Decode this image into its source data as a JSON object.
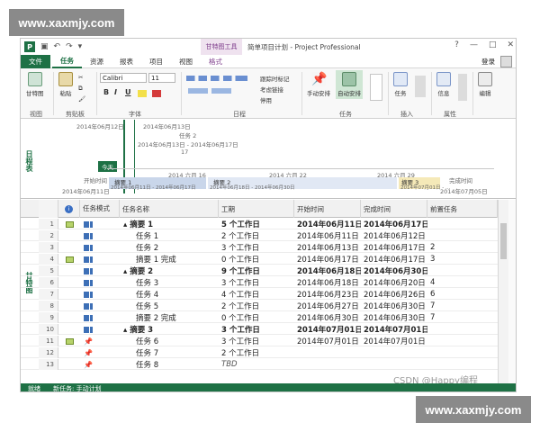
{
  "watermarks": {
    "top": "www.xaxmjy.com",
    "bottom": "www.xaxmjy.com"
  },
  "title_bar": {
    "contextual_tab_title": "甘特图工具",
    "window_title": "简单项目计划 - Project Professional",
    "controls": [
      "?",
      "—",
      "□",
      "✕"
    ]
  },
  "tabs": [
    "文件",
    "任务",
    "资源",
    "报表",
    "项目",
    "视图",
    "格式"
  ],
  "user": {
    "login_label": "登录"
  },
  "ribbon": {
    "view_group": {
      "label": "视图",
      "gantt_button": "甘特图"
    },
    "clipboard_group": {
      "label": "剪贴板",
      "paste_button": "粘贴"
    },
    "font_group": {
      "label": "字体",
      "font_name": "Calibri",
      "font_size": "11",
      "bold": "B",
      "italic": "I",
      "underline": "U"
    },
    "schedule_group": {
      "label": "日程",
      "commands": [
        "跟踪时标记",
        "考虑链接",
        "停用"
      ]
    },
    "tasks_group": {
      "label": "任务",
      "manual_schedule": "手动安排",
      "auto_schedule": "自动安排"
    },
    "insert_group": {
      "label": "插入",
      "task_button": "任务"
    },
    "properties_group": {
      "label": "属性",
      "info_button": "信息"
    },
    "editing_group": {
      "edit_button": "编辑"
    }
  },
  "timeline": {
    "side_label": "日程表",
    "today_label": "今天",
    "top_dates": [
      "2014年06月12日",
      "2014年06月13日"
    ],
    "task2_label": "任务 2",
    "task2_range": "2014年06月13日 - 2014年06月17日",
    "task2_day": "17",
    "axis_dates": [
      "2014 六月 16",
      "2014 六月 22",
      "2014 六月 29"
    ],
    "start_label": "开始时间",
    "start_date": "2014年06月11日",
    "end_label": "完成时间",
    "end_date": "2014年07月05日",
    "bars": [
      {
        "label": "摘要 1",
        "range": "2014年06月11日 - 2014年06月17日",
        "color": "#c9d6ea"
      },
      {
        "label": "摘要 2",
        "range": "2014年06月18日 - 2014年06月30日",
        "color": "#e1e8f4"
      },
      {
        "label": "摘要 3",
        "range": "2014年07月01日 - ...",
        "color": "#f5e9b8"
      }
    ]
  },
  "grid": {
    "side_label": "甘特图",
    "columns": [
      "任务模式",
      "任务名称",
      "工期",
      "开始时间",
      "完成时间",
      "前置任务"
    ],
    "rows": [
      {
        "n": "1",
        "note": true,
        "mode": "auto",
        "name": "▴ 摘要 1",
        "summary": true,
        "duration": "5 个工作日",
        "start": "2014年06月11日",
        "finish": "2014年06月17日",
        "pred": ""
      },
      {
        "n": "2",
        "note": false,
        "mode": "auto",
        "name": "任务 1",
        "summary": false,
        "duration": "2 个工作日",
        "start": "2014年06月11日",
        "finish": "2014年06月12日",
        "pred": ""
      },
      {
        "n": "3",
        "note": false,
        "mode": "auto",
        "name": "任务 2",
        "summary": false,
        "duration": "3 个工作日",
        "start": "2014年06月13日",
        "finish": "2014年06月17日",
        "pred": "2"
      },
      {
        "n": "4",
        "note": true,
        "mode": "auto",
        "name": "摘要 1 完成",
        "summary": false,
        "duration": "0 个工作日",
        "start": "2014年06月17日",
        "finish": "2014年06月17日",
        "pred": "3"
      },
      {
        "n": "5",
        "note": false,
        "mode": "auto",
        "name": "▴ 摘要 2",
        "summary": true,
        "duration": "9 个工作日",
        "start": "2014年06月18日",
        "finish": "2014年06月30日",
        "pred": ""
      },
      {
        "n": "6",
        "note": false,
        "mode": "auto",
        "name": "任务 3",
        "summary": false,
        "duration": "3 个工作日",
        "start": "2014年06月18日",
        "finish": "2014年06月20日",
        "pred": "4"
      },
      {
        "n": "7",
        "note": false,
        "mode": "auto",
        "name": "任务 4",
        "summary": false,
        "duration": "4 个工作日",
        "start": "2014年06月23日",
        "finish": "2014年06月26日",
        "pred": "6"
      },
      {
        "n": "8",
        "note": false,
        "mode": "auto",
        "name": "任务 5",
        "summary": false,
        "duration": "2 个工作日",
        "start": "2014年06月27日",
        "finish": "2014年06月30日",
        "pred": "7"
      },
      {
        "n": "9",
        "note": false,
        "mode": "auto",
        "name": "摘要 2 完成",
        "summary": false,
        "duration": "0 个工作日",
        "start": "2014年06月30日",
        "finish": "2014年06月30日",
        "pred": "7"
      },
      {
        "n": "10",
        "note": false,
        "mode": "auto",
        "name": "▴ 摘要 3",
        "summary": true,
        "duration": "3 个工作日",
        "start": "2014年07月01日",
        "finish": "2014年07月01日",
        "pred": ""
      },
      {
        "n": "11",
        "note": true,
        "mode": "manual",
        "name": "任务 6",
        "summary": false,
        "duration": "3 个工作日",
        "start": "2014年07月01日",
        "finish": "2014年07月01日",
        "pred": ""
      },
      {
        "n": "12",
        "note": false,
        "mode": "manual",
        "name": "任务 7",
        "summary": false,
        "duration": "2 个工作日",
        "start": "",
        "finish": "",
        "pred": ""
      },
      {
        "n": "13",
        "note": false,
        "mode": "manual",
        "name": "任务 8",
        "summary": false,
        "duration": "TBD",
        "start": "",
        "finish": "",
        "pred": ""
      }
    ]
  },
  "status_bar": {
    "ready": "就绪",
    "new_task": "新任务: 手动计划"
  },
  "overlay_text": "CSDN @Happy编程",
  "colors": {
    "accent": "#1e7145",
    "context": "#7c3a8a"
  }
}
